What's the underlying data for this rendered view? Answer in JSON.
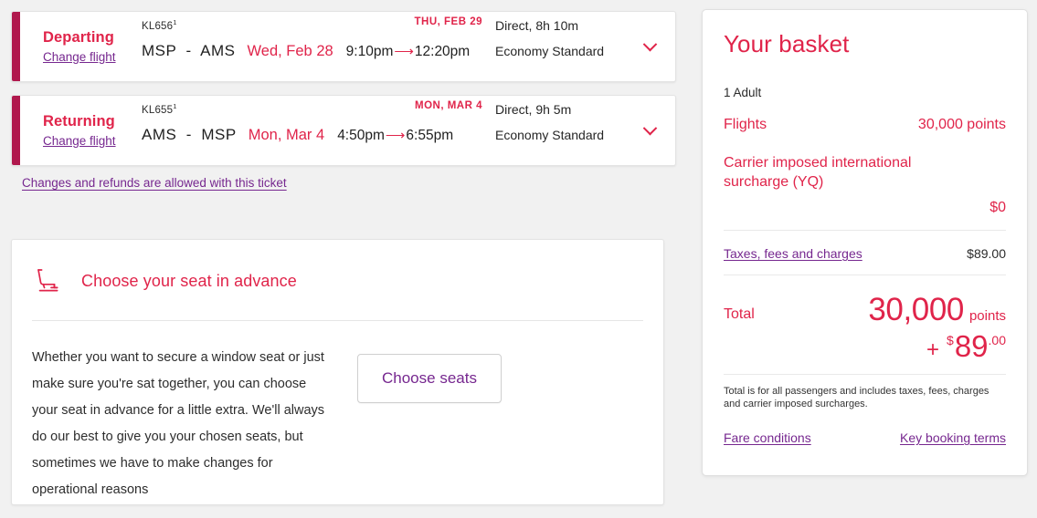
{
  "flights": [
    {
      "direction": "Departing",
      "change_link": "Change flight",
      "flight_number": "KL656",
      "flight_number_sup": "1",
      "route": "MSP  -  AMS",
      "depart_date": "Wed, Feb 28",
      "depart_time": "9:10pm",
      "arrive_time": "12:20pm",
      "arrive_date_label": "THU, FEB 29",
      "duration": "Direct, 8h 10m",
      "cabin": "Economy Standard",
      "expand_icon": "chevron-down-icon"
    },
    {
      "direction": "Returning",
      "change_link": "Change flight",
      "flight_number": "KL655",
      "flight_number_sup": "1",
      "route": "AMS  -  MSP",
      "depart_date": "Mon, Mar 4",
      "depart_time": "4:50pm",
      "arrive_time": "6:55pm",
      "arrive_date_label": "MON, MAR 4",
      "duration": "Direct, 9h 5m",
      "cabin": "Economy Standard",
      "expand_icon": "chevron-down-icon"
    }
  ],
  "refund_note": "Changes and refunds are allowed with this ticket",
  "seat_card": {
    "icon": "airplane-seat-icon",
    "title": "Choose your seat in advance",
    "body": "Whether you want to secure a window seat or just make sure you're sat together, you can choose your seat in advance for a little extra. We'll always do our best to give you your chosen seats, but sometimes we have to make changes for operational reasons",
    "button_label": "Choose seats"
  },
  "basket": {
    "title": "Your basket",
    "passengers": "1 Adult",
    "flights_label": "Flights",
    "flights_value": "30,000 points",
    "surcharge_label": "Carrier imposed international surcharge (YQ)",
    "surcharge_value": "$0",
    "taxes_label": "Taxes, fees and charges",
    "taxes_value": "$89.00",
    "total_label": "Total",
    "total_points": "30,000",
    "total_points_word": "points",
    "total_plus": "+",
    "total_currency": "$",
    "total_cash": "89",
    "total_cents": ".00",
    "fineprint": "Total is for all passengers and includes taxes, fees, charges and carrier imposed surcharges.",
    "fare_conditions_link": "Fare conditions",
    "key_terms_link": "Key booking terms"
  },
  "colors": {
    "brand_red": "#e0244a",
    "accent_bar": "#b0184d",
    "link_purple": "#76278f",
    "page_bg": "#f1f1f1"
  }
}
